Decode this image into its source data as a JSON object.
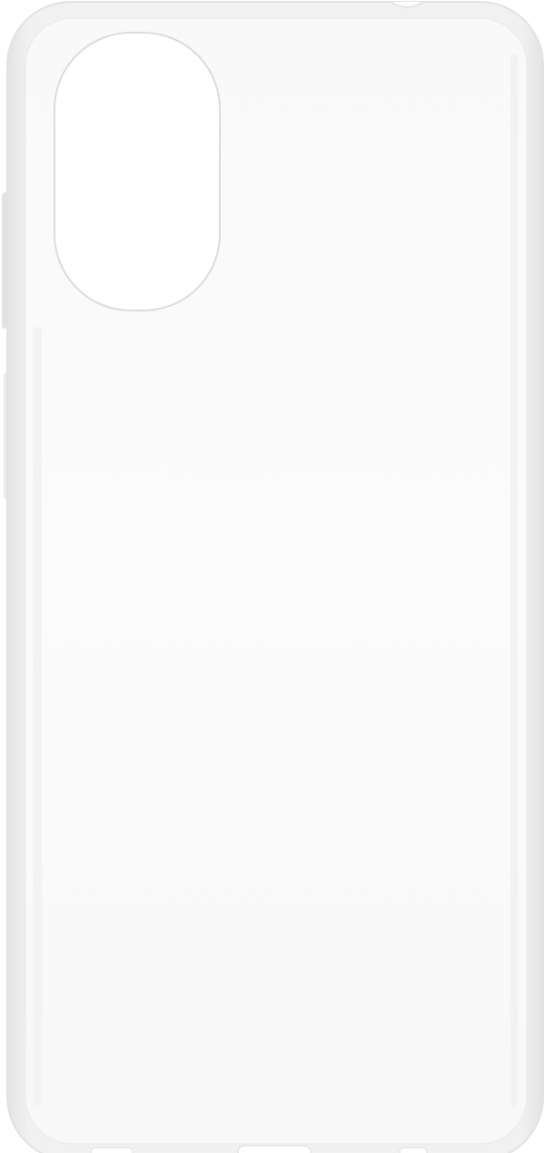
{
  "product": {
    "subject": "clear-phone-case-back",
    "colors": {
      "background": "#ffffff",
      "case_body": "#f7f7f7",
      "case_rim": "#e6e6e6",
      "case_inner": "#fafafa",
      "camera_cutout": "#ffffff",
      "camera_outline": "#dedede",
      "button_cover": "#e2e2e2"
    }
  }
}
